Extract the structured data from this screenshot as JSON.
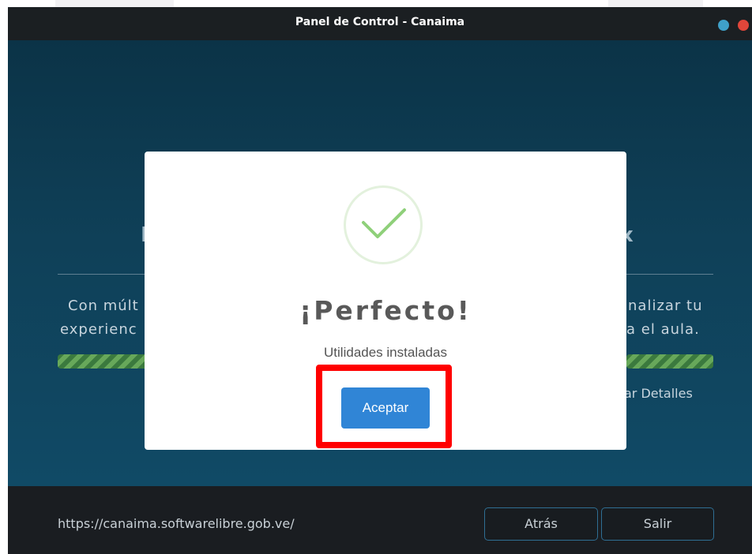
{
  "window": {
    "title": "Panel de Control - Canaima",
    "controls": [
      "minimize",
      "close"
    ],
    "colors": {
      "minimize": "#3fa0c8",
      "close": "#e0463a"
    }
  },
  "background": {
    "heading_left": "I",
    "heading_right": "x",
    "description_left_line1": "Con múlt",
    "description_left_line2": "experienc",
    "description_right_line1": "nalizar tu",
    "description_right_line2": "ta el aula.",
    "details_link": "ar Detalles"
  },
  "dialog": {
    "icon": "checkmark-icon",
    "title": "¡Perfecto!",
    "message": "Utilidades instaladas",
    "accept_label": "Aceptar",
    "accent": "#3085d6"
  },
  "footer": {
    "url": "https://canaima.softwarelibre.gob.ve/",
    "back_label": "Atrás",
    "exit_label": "Salir"
  }
}
